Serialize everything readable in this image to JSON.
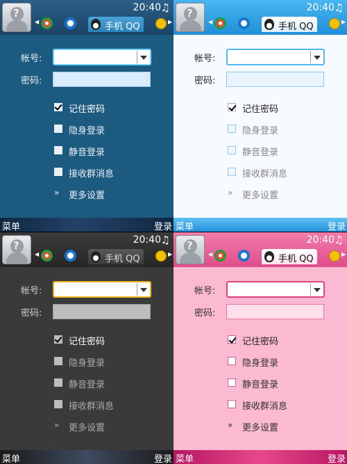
{
  "status": {
    "time": "20:40",
    "music_icon": "music-note-icon"
  },
  "avatar": {
    "placeholder": "?"
  },
  "tab": {
    "label": "手机 QQ"
  },
  "form": {
    "account_label": "帐号:",
    "account_value": "",
    "password_label": "密码:",
    "password_value": ""
  },
  "options": [
    {
      "label": "记住密码",
      "checked": true
    },
    {
      "label": "隐身登录",
      "checked": false
    },
    {
      "label": "静音登录",
      "checked": false
    },
    {
      "label": "接收群消息",
      "checked": false
    }
  ],
  "more_settings": {
    "chevron": "»",
    "label": "更多设置"
  },
  "softkeys": {
    "left": "菜单",
    "right": "登录"
  },
  "themes": [
    {
      "name": "blue",
      "accent": "#6fd4ff"
    },
    {
      "name": "light-blue",
      "accent": "#52b8f0"
    },
    {
      "name": "dark",
      "accent": "#f3b21b"
    },
    {
      "name": "pink",
      "accent": "#e0417f"
    }
  ]
}
